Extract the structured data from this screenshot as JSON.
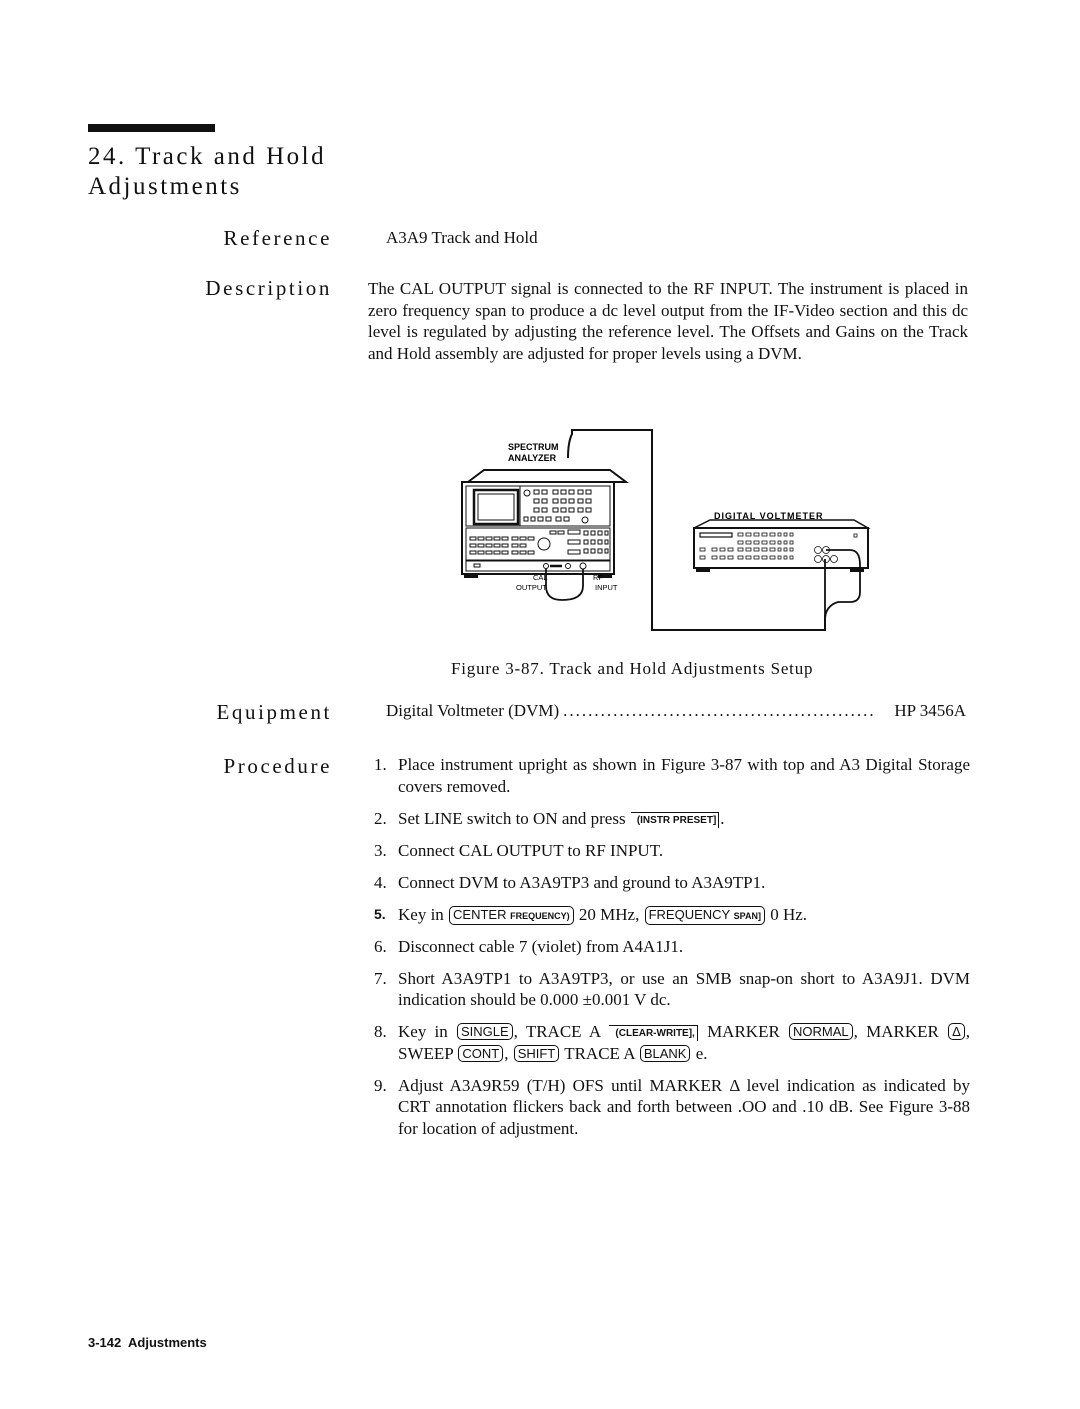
{
  "section": {
    "number": "24.",
    "title_line1": "Track and Hold",
    "title_line2": "Adjustments"
  },
  "labels": {
    "reference": "Reference",
    "description": "Description",
    "equipment": "Equipment",
    "procedure": "Procedure"
  },
  "reference": "A3A9 Track and Hold",
  "description": "The CAL OUTPUT signal is connected to the RF INPUT. The instrument is placed in zero frequency span to produce a dc level output from the IF-Video section and this dc level is regulated by adjusting the reference level. The Offsets and Gains on the Track and Hold assembly are adjusted for proper levels using a DVM.",
  "figure": {
    "spectrum_analyzer_label_1": "SPECTRUM",
    "spectrum_analyzer_label_2": "ANALYZER",
    "cal_output_1": "CAL",
    "cal_output_2": "OUTPUT",
    "rf_input_1": "RF",
    "rf_input_2": "INPUT",
    "dvm_label": "DIGITAL VOLTMETER",
    "caption": "Figure 3-87. Track and Hold Adjustments Setup"
  },
  "equipment": {
    "name": "Digital Voltmeter (DVM)",
    "dots": "..................................................",
    "model": "HP 3456A"
  },
  "steps": [
    {
      "num": "1.",
      "text": "Place instrument upright as shown in Figure 3-87 with top and A3 Digital Storage covers removed."
    },
    {
      "num": "2.",
      "pre": "Set LINE switch to ON and press",
      "key1": "(INSTR PRESET]",
      "post": "."
    },
    {
      "num": "3.",
      "text": "Connect CAL OUTPUT to RF INPUT."
    },
    {
      "num": "4.",
      "text": "Connect DVM to A3A9TP3 and ground to A3A9TP1."
    },
    {
      "num": "5.",
      "pre": "Key in",
      "key1_main": "CENTER",
      "key1_sub": "FREQUENCY)",
      "mid": "20 MHz,",
      "key2_main": "FREQUENCY",
      "key2_sub": "SPAN]",
      "post": "0 Hz."
    },
    {
      "num": "6.",
      "text": "Disconnect cable 7 (violet) from A4A1J1."
    },
    {
      "num": "7.",
      "text": "Short A3A9TP1 to A3A9TP3, or use an SMB snap-on short to A3A9J1. DVM indication should be 0.000 ±0.001 V dc."
    },
    {
      "num": "8.",
      "t1": "Key in",
      "k1": "SINGLE",
      "t2": ", TRACE A",
      "k2": "(CLEAR-WRITE],",
      "t3": "MARKER",
      "k3": "NORMAL",
      "t4": ", MARKER",
      "k4": "Δ",
      "t5": ", SWEEP",
      "k5": "CONT",
      "t6": ",",
      "k6": "SHIFT",
      "t7": "TRACE A",
      "k7": "BLANK",
      "t8": "e."
    },
    {
      "num": "9.",
      "text": "Adjust A3A9R59 (T/H) OFS until MARKER Δ level indication as indicated by CRT annotation flickers back and forth between .OO and .10 dB. See Figure 3-88 for location of adjustment."
    }
  ],
  "footer": {
    "page": "3-142",
    "chapter": "Adjustments"
  }
}
